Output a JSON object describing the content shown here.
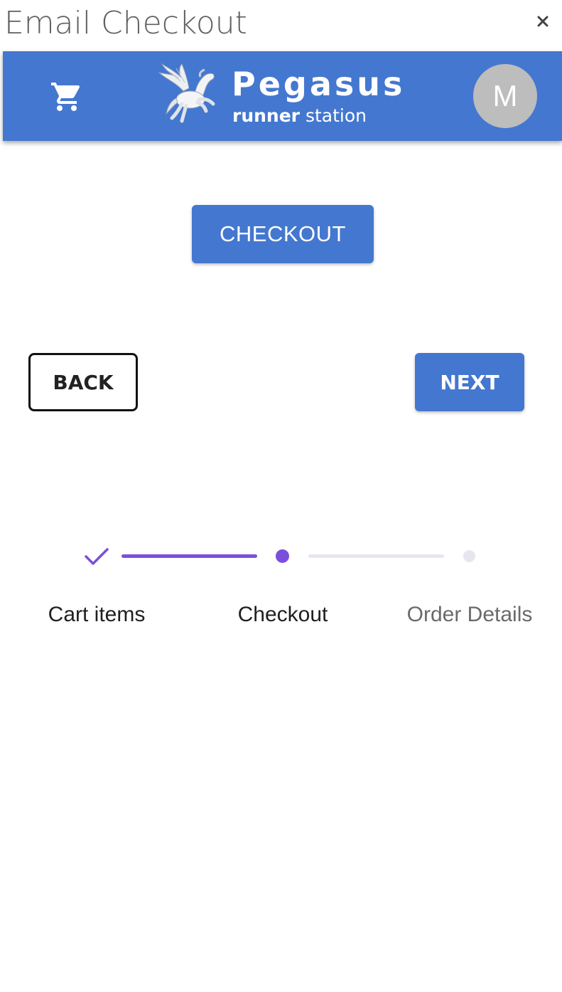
{
  "window": {
    "title": "Email Checkout",
    "close_icon": "close-icon"
  },
  "header": {
    "cart_icon": "shopping-cart-icon",
    "logo_icon": "pegasus-logo-icon",
    "brand_name": "Pegasus",
    "tagline_strong": "runner",
    "tagline_rest": " station",
    "avatar_initial": "M",
    "accent_color": "#4477cf"
  },
  "main": {
    "checkout_label": "CHECKOUT"
  },
  "navigation": {
    "back_label": "BACK",
    "next_label": "NEXT"
  },
  "stepper": {
    "active_color": "#7b4fdc",
    "inactive_color": "#e6e6ee",
    "steps": [
      {
        "label": "Cart items",
        "state": "completed",
        "icon": "check-icon"
      },
      {
        "label": "Checkout",
        "state": "active"
      },
      {
        "label": "Order Details",
        "state": "pending"
      }
    ]
  }
}
